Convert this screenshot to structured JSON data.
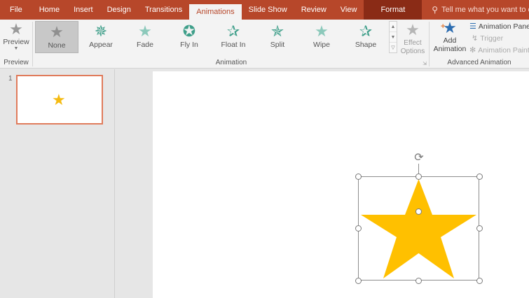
{
  "tabs": [
    {
      "label": "File",
      "kind": "file"
    },
    {
      "label": "Home"
    },
    {
      "label": "Insert"
    },
    {
      "label": "Design"
    },
    {
      "label": "Transitions"
    },
    {
      "label": "Animations",
      "active": true
    },
    {
      "label": "Slide Show"
    },
    {
      "label": "Review"
    },
    {
      "label": "View"
    },
    {
      "label": "Format",
      "kind": "format"
    }
  ],
  "tell_me": {
    "icon": "lightbulb-icon",
    "placeholder": "Tell me what you want to do..."
  },
  "ribbon": {
    "preview": {
      "label": "Preview",
      "group_label": "Preview",
      "icon": "preview-star-icon"
    },
    "animation_group_label": "Animation",
    "animations": [
      {
        "label": "None",
        "icon": "star-icon",
        "selected": true
      },
      {
        "label": "Appear",
        "icon": "star-burst-icon"
      },
      {
        "label": "Fade",
        "icon": "star-icon"
      },
      {
        "label": "Fly In",
        "icon": "star-fly-icon"
      },
      {
        "label": "Float In",
        "icon": "star-outline-icon"
      },
      {
        "label": "Split",
        "icon": "star-split-icon"
      },
      {
        "label": "Wipe",
        "icon": "star-icon"
      },
      {
        "label": "Shape",
        "icon": "star-outline-icon"
      }
    ],
    "effect_options": {
      "line1": "Effect",
      "line2": "Options",
      "icon": "star-icon"
    },
    "add_animation": {
      "line1": "Add",
      "line2": "Animation",
      "icon": "add-star-icon"
    },
    "animation_pane": "Animation Pane",
    "trigger": "Trigger",
    "animation_painter": "Animation Painter",
    "advanced_group_label": "Advanced Animation"
  },
  "thumbnails": [
    {
      "number": "1",
      "icon": "star-icon"
    }
  ],
  "colors": {
    "accent": "#b7472a",
    "star_fill": "#ffc000",
    "animation_icon": "#3f9f8a"
  }
}
